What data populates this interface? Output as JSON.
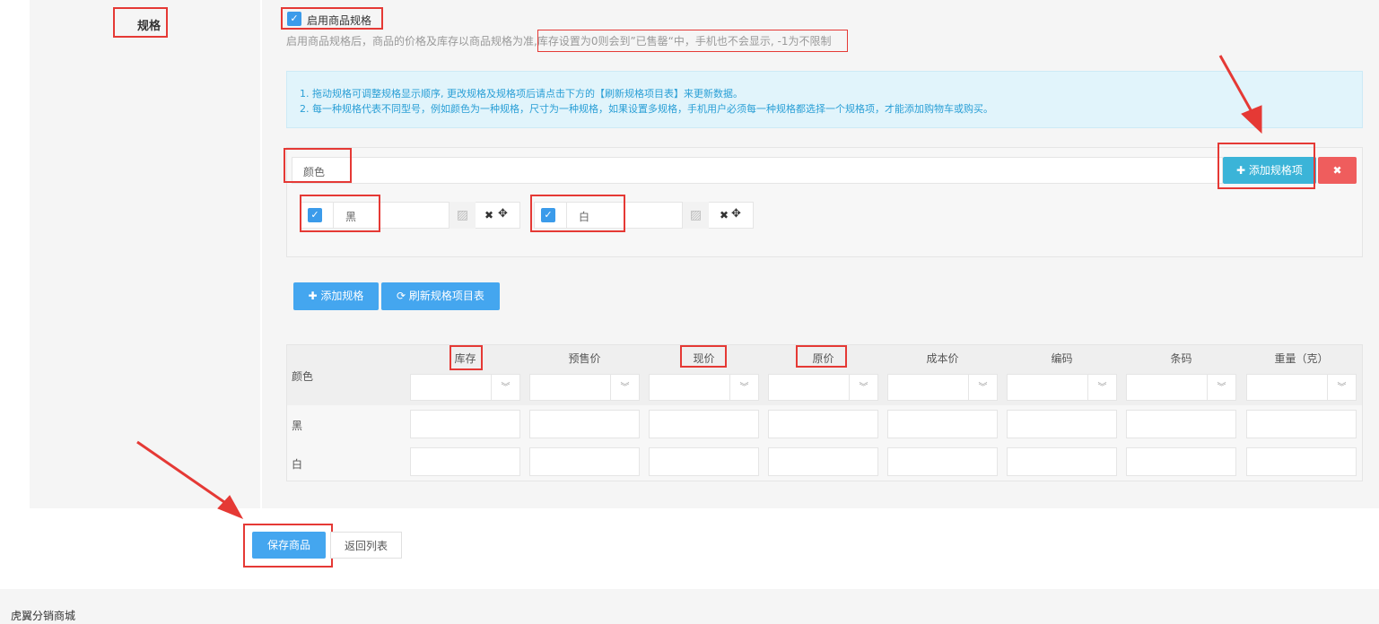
{
  "section": {
    "label": "规格"
  },
  "enable_spec": {
    "label": "启用商品规格",
    "checked": true
  },
  "hint": {
    "prefix": "启用商品规格后，商品的价格及库存以商品规格为准,",
    "highlight": "库存设置为0则会到”已售罄“中，手机也不会显示, -1为不限制"
  },
  "info": {
    "line1": "1. 拖动规格可调整规格显示顺序, 更改规格及规格项后请点击下方的【刷新规格项目表】来更新数据。",
    "line2": "2. 每一种规格代表不同型号，例如颜色为一种规格，尺寸为一种规格，如果设置多规格，手机用户必须每一种规格都选择一个规格项，才能添加购物车或购买。"
  },
  "spec": {
    "name_value": "颜色",
    "add_item_label": "添加规格项",
    "delete_icon": "close-icon",
    "items": [
      {
        "value": "黑",
        "checked": true
      },
      {
        "value": "白",
        "checked": true
      }
    ]
  },
  "buttons": {
    "add_spec": "添加规格",
    "refresh": "刷新规格项目表",
    "save": "保存商品",
    "back": "返回列表"
  },
  "table": {
    "row_header": "颜色",
    "columns": [
      "库存",
      "预售价",
      "现价",
      "原价",
      "成本价",
      "编码",
      "条码",
      "重量（克）"
    ],
    "rows": [
      "黑",
      "白"
    ]
  },
  "footer": {
    "text": "虎翼分销商城"
  },
  "colors": {
    "accent": "#44a6ef",
    "add_item": "#3bb4d8",
    "danger": "#ef5d5d",
    "info_bg": "#e1f4fb",
    "info_text": "#2a9fd6",
    "annotation": "#e53935"
  }
}
